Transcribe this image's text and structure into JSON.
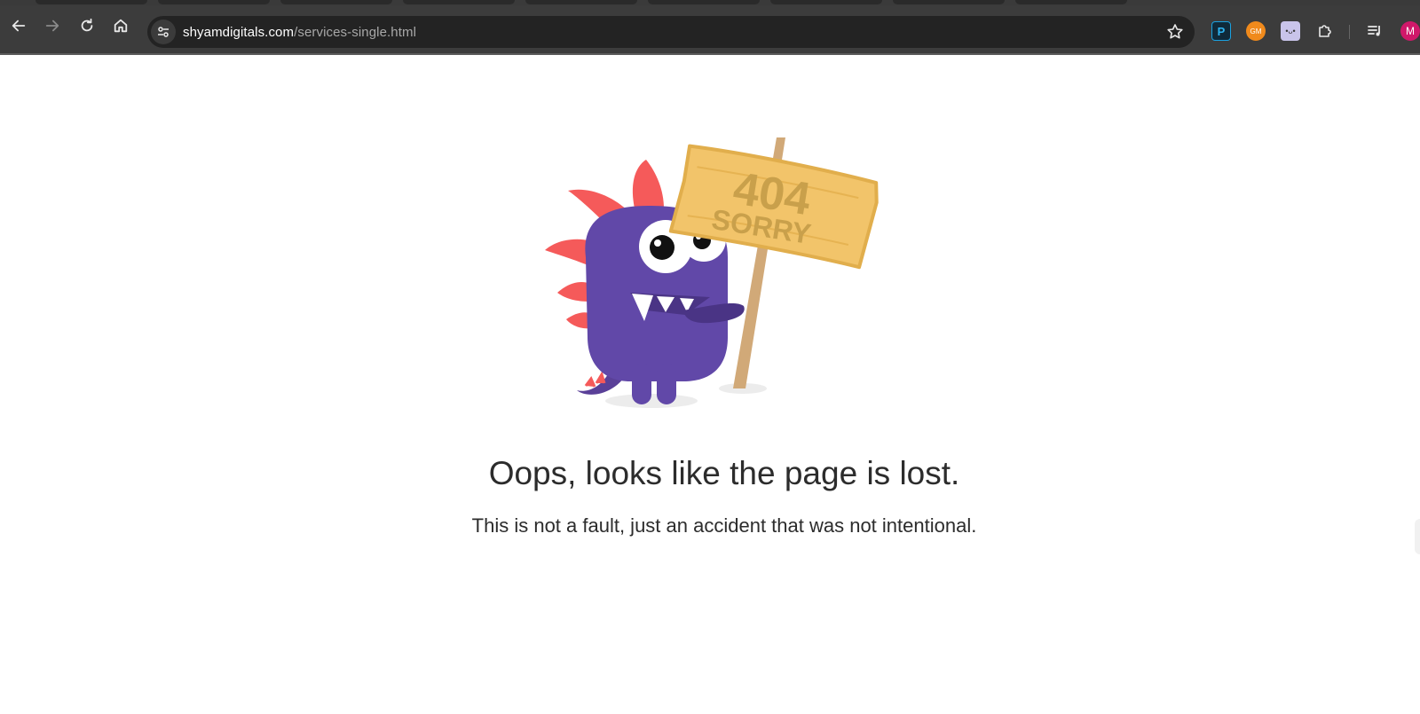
{
  "browser": {
    "url_domain": "shyamdigitals.com",
    "url_path": "/services-single.html",
    "profile_initial": "M",
    "extensions": [
      "p-extension-icon",
      "gm-extension-icon",
      "face-extension-icon"
    ],
    "ext_gm_label": "GM"
  },
  "page": {
    "sign_code": "404",
    "sign_word": "SORRY",
    "heading": "Oops, looks like the page is lost.",
    "subtext": "This is not a fault, just an accident that was not intentional."
  },
  "colors": {
    "monster_body": "#6148a8",
    "monster_spikes": "#f55a5a",
    "sign": "#f2c46a",
    "sign_text": "#c9a04b",
    "pole": "#d1a978"
  }
}
